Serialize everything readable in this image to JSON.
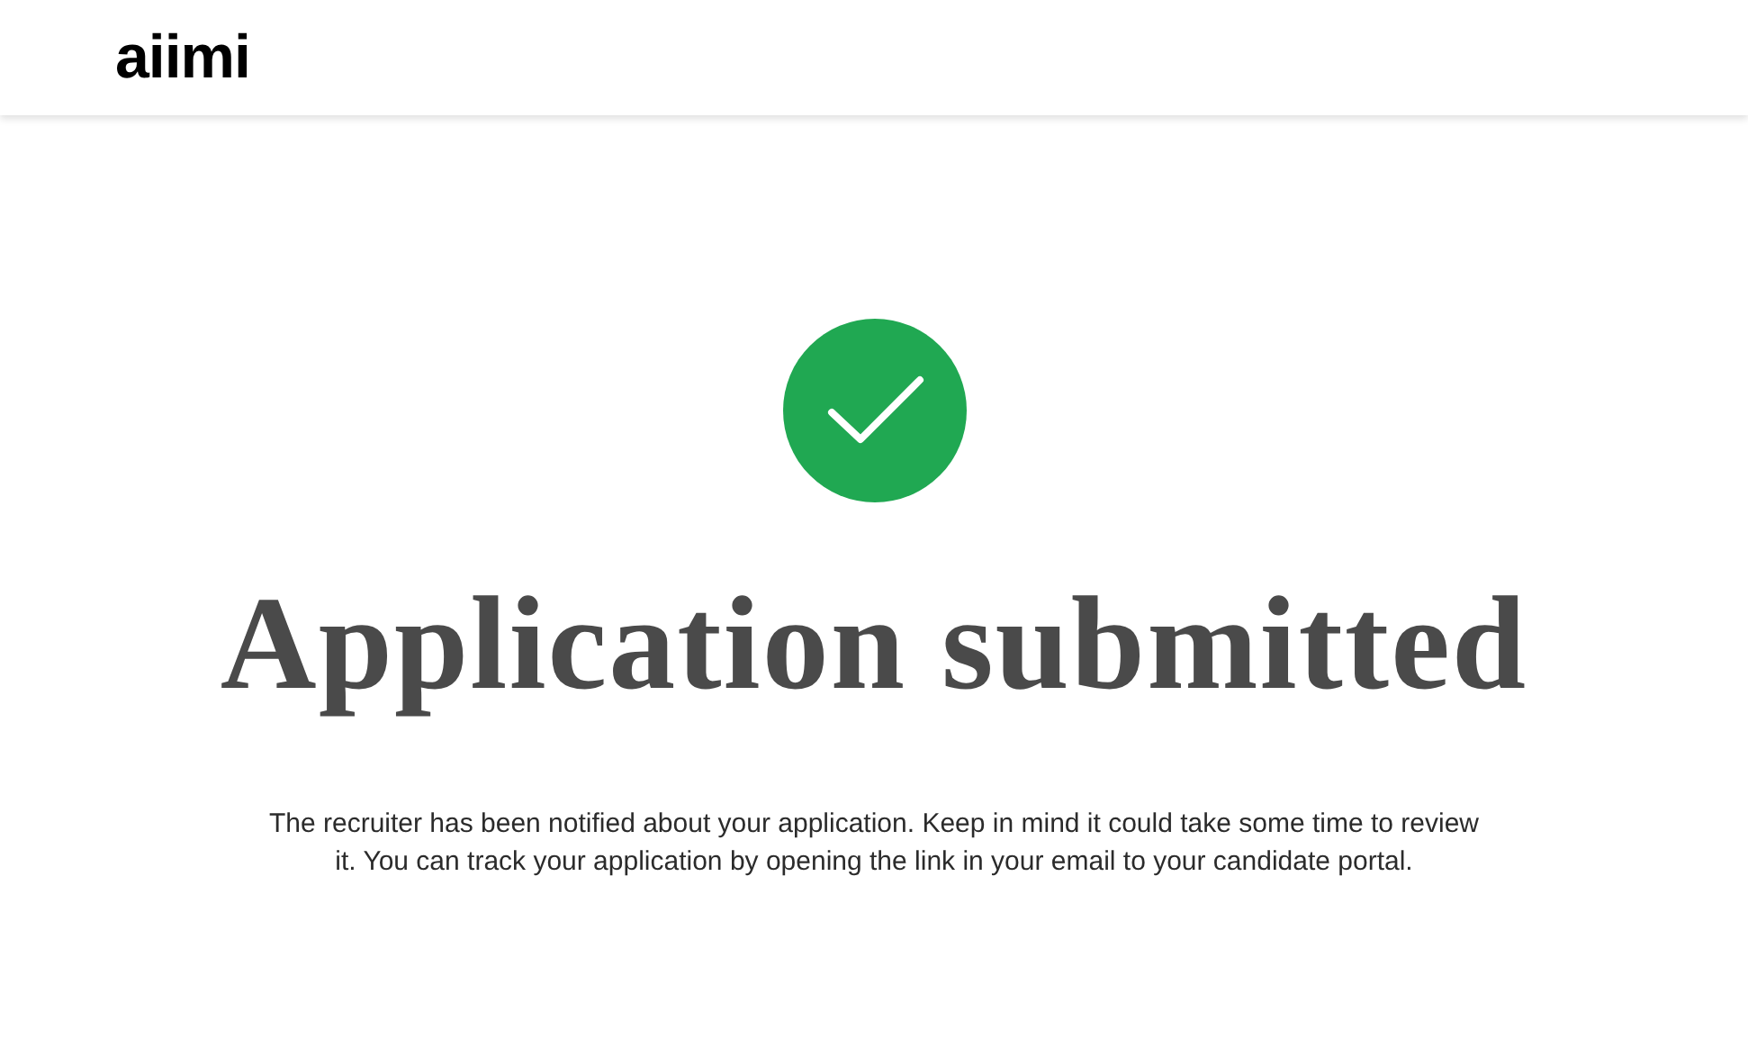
{
  "header": {
    "logo": "aiimi"
  },
  "confirmation": {
    "title": "Application submitted",
    "message": "The recruiter has been notified about your application. Keep in mind it could take some time to review it. You can track your application by opening the link in your email to your candidate portal."
  }
}
